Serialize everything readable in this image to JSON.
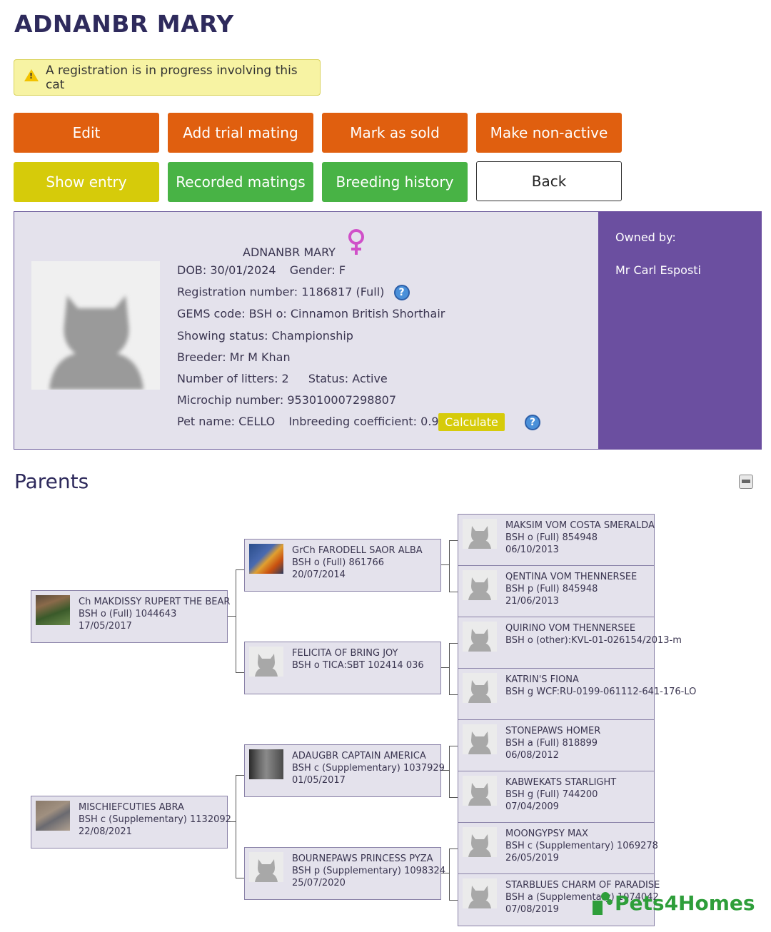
{
  "page": {
    "title": "ADNANBR MARY"
  },
  "notice": {
    "text": "A registration is in progress involving this cat"
  },
  "buttons": {
    "edit": "Edit",
    "add_trial_mating": "Add trial mating",
    "mark_as_sold": "Mark as sold",
    "make_non_active": "Make non-active",
    "show_entry": "Show entry",
    "recorded_matings": "Recorded matings",
    "breeding_history": "Breeding history",
    "back": "Back"
  },
  "profile": {
    "name": "ADNANBR MARY",
    "dob": "DOB: 30/01/2024",
    "gender": "Gender: F",
    "registration": "Registration number: 1186817 (Full)",
    "gems": "GEMS code: BSH o: Cinnamon British Shorthair",
    "showing": "Showing status: Championship",
    "breeder": "Breeder: Mr M Khan",
    "litters": "Number of litters: 2",
    "status": "Status: Active",
    "microchip": "Microchip number: 953010007298807",
    "pet_name": "Pet name: CELLO",
    "inbreeding": "Inbreeding coefficient: 0.96%",
    "calculate": "Calculate"
  },
  "owner": {
    "label": "Owned by:",
    "name": "Mr Carl Esposti"
  },
  "parents": {
    "heading": "Parents",
    "sire": {
      "l1": "Ch MAKDISSY RUPERT THE BEAR",
      "l2": "BSH o (Full) 1044643",
      "l3": "17/05/2017"
    },
    "dam": {
      "l1": "MISCHIEFCUTIES ABRA",
      "l2": "BSH c (Supplementary) 1132092",
      "l3": "22/08/2021"
    },
    "gp1": {
      "l1": "GrCh FARODELL SAOR ALBA",
      "l2": "BSH o (Full) 861766",
      "l3": "20/07/2014"
    },
    "gp2": {
      "l1": "FELICITA OF BRING JOY",
      "l2": "BSH o TICA:SBT 102414 036",
      "l3": ""
    },
    "gp3": {
      "l1": "ADAUGBR CAPTAIN AMERICA",
      "l2": "BSH c (Supplementary) 1037929",
      "l3": "01/05/2017"
    },
    "gp4": {
      "l1": "BOURNEPAWS PRINCESS PYZA",
      "l2": "BSH p (Supplementary) 1098324",
      "l3": "25/07/2020"
    },
    "ggp1": {
      "l1": "MAKSIM VOM COSTA SMERALDA",
      "l2": "BSH o (Full) 854948",
      "l3": "06/10/2013"
    },
    "ggp2": {
      "l1": "QENTINA VOM THENNERSEE",
      "l2": "BSH p (Full) 845948",
      "l3": "21/06/2013"
    },
    "ggp3": {
      "l1": "QUIRINO VOM THENNERSEE",
      "l2": "BSH o (other):KVL-01-026154/2013-m",
      "l3": ""
    },
    "ggp4": {
      "l1": "KATRIN'S FIONA",
      "l2": "BSH g WCF:RU-0199-061112-641-176-LO",
      "l3": ""
    },
    "ggp5": {
      "l1": "STONEPAWS HOMER",
      "l2": "BSH a (Full) 818899",
      "l3": "06/08/2012"
    },
    "ggp6": {
      "l1": "KABWEKATS STARLIGHT",
      "l2": "BSH g (Full) 744200",
      "l3": "07/04/2009"
    },
    "ggp7": {
      "l1": "MOONGYPSY MAX",
      "l2": "BSH c (Supplementary) 1069278",
      "l3": "26/05/2019"
    },
    "ggp8": {
      "l1": "STARBLUES CHARM OF PARADISE",
      "l2": "BSH a (Supplementary) 1074042",
      "l3": "07/08/2019"
    }
  },
  "watermark": "Pets4Homes",
  "icons": {
    "warning": "warning-icon",
    "female": "female-icon",
    "help": "help-icon",
    "collapse": "collapse-icon",
    "cat_placeholder": "cat-silhouette-icon"
  },
  "colors": {
    "orange": "#e05f0f",
    "yellow": "#d6cb0a",
    "green": "#48b345",
    "purple": "#6b4fa0",
    "title": "#2e2a5c"
  }
}
